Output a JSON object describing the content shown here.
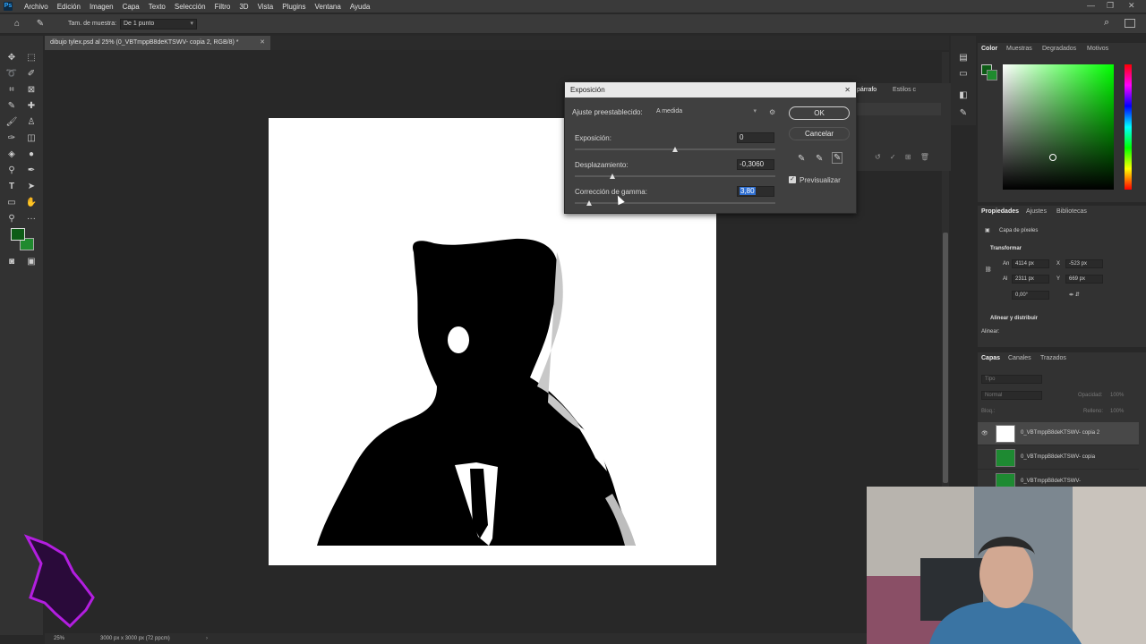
{
  "app": {
    "logo": "Ps"
  },
  "menu": [
    "Archivo",
    "Edición",
    "Imagen",
    "Capa",
    "Texto",
    "Selección",
    "Filtro",
    "3D",
    "Vista",
    "Plugins",
    "Ventana",
    "Ayuda"
  ],
  "options_bar": {
    "sample_size_label": "Tam. de muestra:",
    "sample_size_value": "De 1 punto"
  },
  "document_tab": {
    "title": "dibujo tylex.psd al 25% (0_VBTmppB8deKTSWV- copia 2, RGB/8) *"
  },
  "status_bar": {
    "zoom": "25%",
    "doc_info": "3000 px x 3000 px (72 ppcm)"
  },
  "dialog": {
    "title": "Exposición",
    "preset_label": "Ajuste preestablecido:",
    "preset_value": "A medida",
    "exposure_label": "Exposición:",
    "exposure_value": "0",
    "offset_label": "Desplazamiento:",
    "offset_value": "-0,3060",
    "gamma_label": "Corrección de gamma:",
    "gamma_value": "3,80",
    "ok_label": "OK",
    "cancel_label": "Cancelar",
    "preview_label": "Previsualizar",
    "preview_checked": true
  },
  "behind_panels": {
    "paragraph_tab": "párrafo",
    "styles_tab": "Estilos c"
  },
  "color_panel": {
    "tabs": [
      "Color",
      "Muestras",
      "Degradados",
      "Motivos"
    ],
    "foreground": "#0d5c16",
    "background": "#1f8a2e"
  },
  "properties_panel": {
    "tabs": [
      "Propiedades",
      "Ajustes",
      "Bibliotecas"
    ],
    "layer_type": "Capa de píxeles",
    "transform_label": "Transformar",
    "width_label": "An",
    "width_value": "4114 px",
    "height_label": "Al",
    "height_value": "2311 px",
    "x_label": "X",
    "x_value": "-523 px",
    "y_label": "Y",
    "y_value": "669 px",
    "angle_value": "0,00°",
    "align_label": "Alinear y distribuir",
    "align_sub": "Alinear:"
  },
  "layers_panel": {
    "tabs": [
      "Capas",
      "Canales",
      "Trazados"
    ],
    "search_placeholder": "Tipo",
    "blend_mode": "Normal",
    "opacity_label": "Opacidad:",
    "opacity_value": "100%",
    "lock_label": "Bloq.:",
    "fill_label": "Relleno:",
    "fill_value": "100%",
    "layers": [
      {
        "name": "0_VBTmppB8deKTSWV- copia 2"
      },
      {
        "name": "0_VBTmppB8deKTSWV- copia"
      },
      {
        "name": "0_VBTmppB8deKTSWV-"
      }
    ]
  }
}
